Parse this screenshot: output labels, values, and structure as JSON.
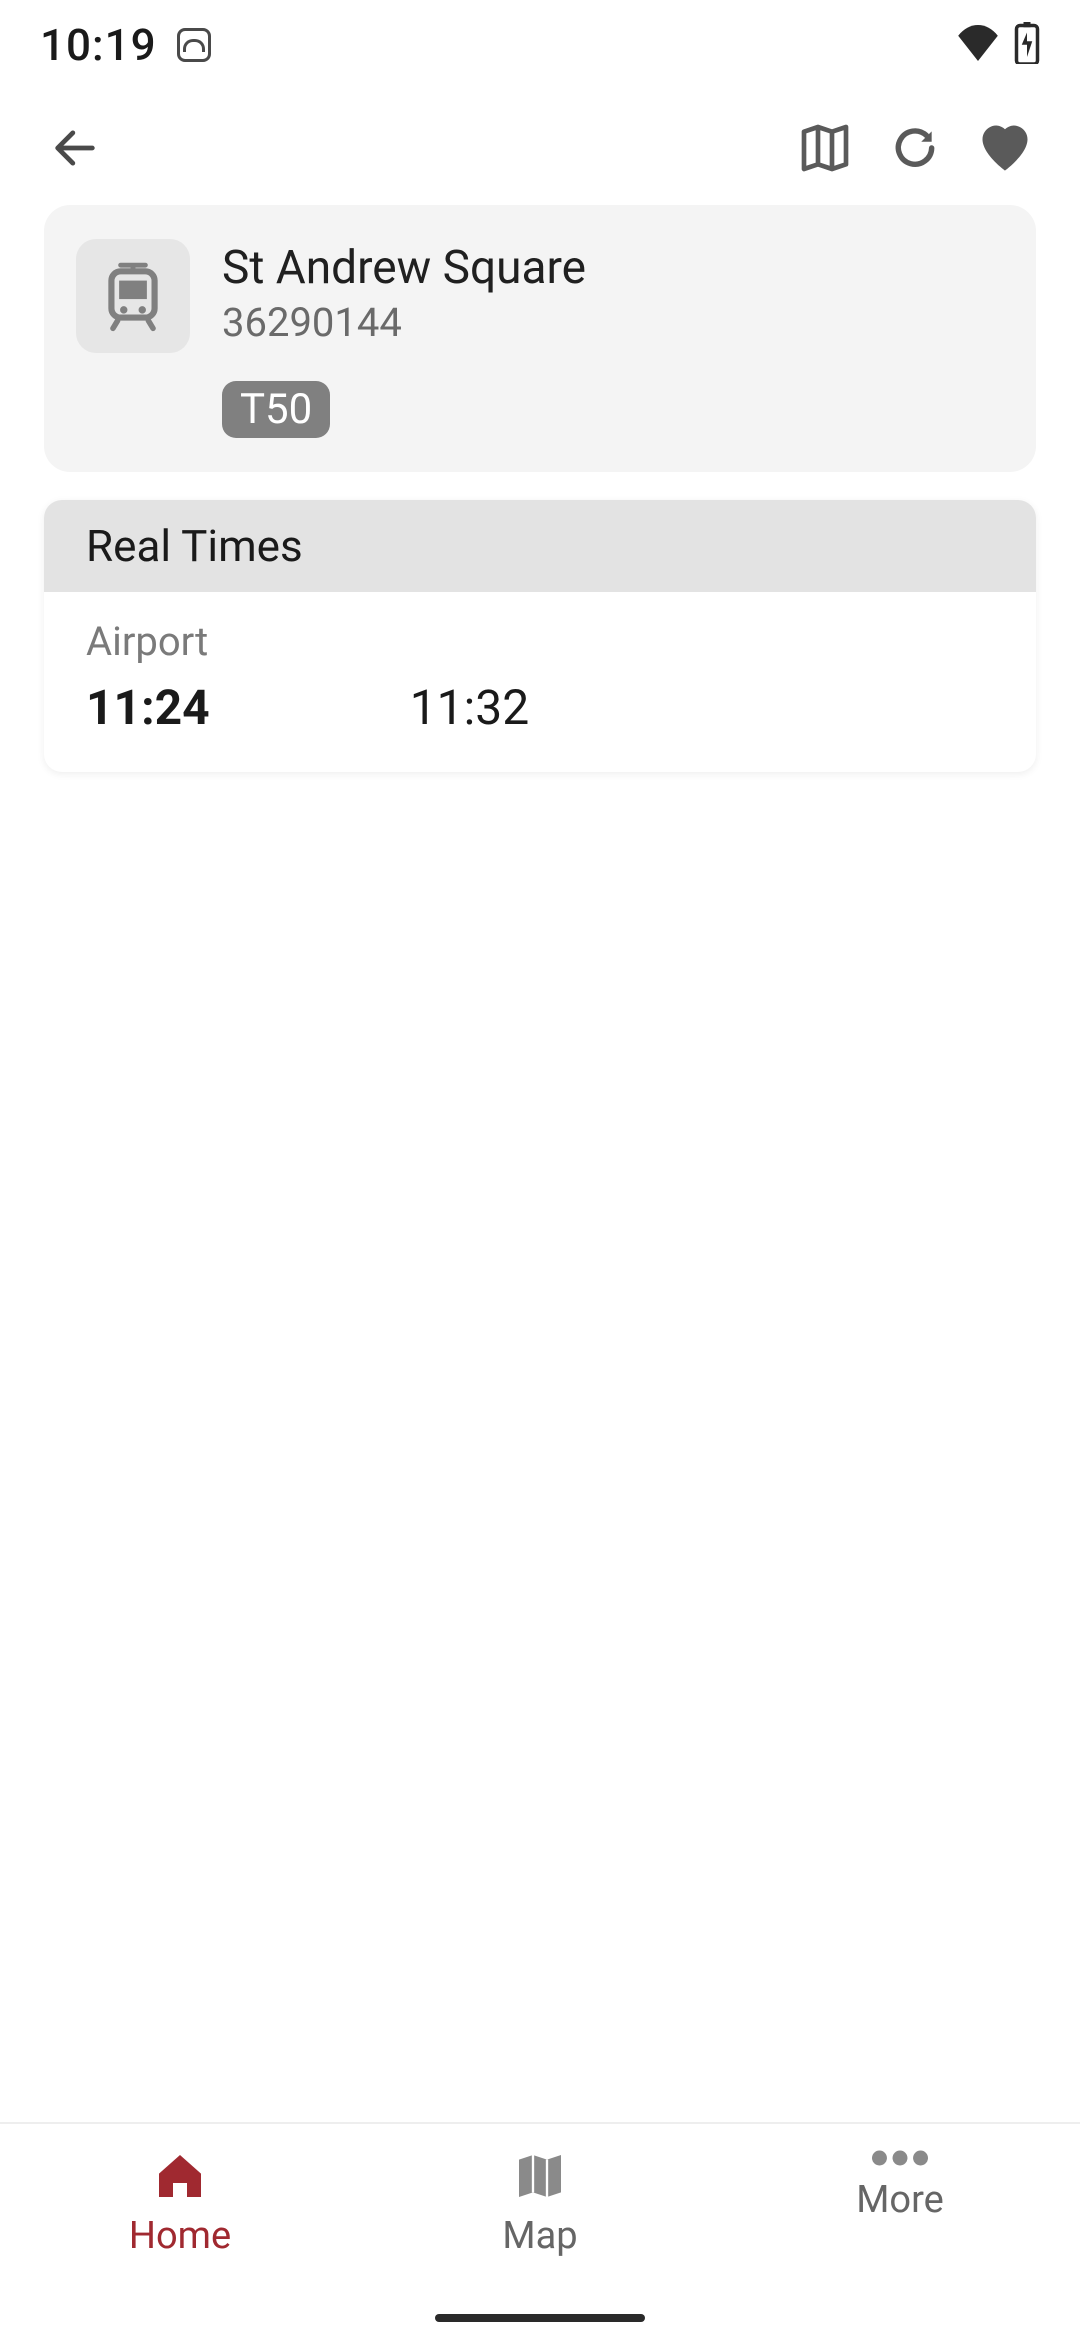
{
  "status": {
    "time": "10:19"
  },
  "stop": {
    "name": "St Andrew Square",
    "id": "36290144",
    "route_badge": "T50"
  },
  "real_times": {
    "heading": "Real Times",
    "destination": "Airport",
    "times": [
      "11:24",
      "11:32"
    ]
  },
  "nav": {
    "home": "Home",
    "map": "Map",
    "more": "More"
  }
}
